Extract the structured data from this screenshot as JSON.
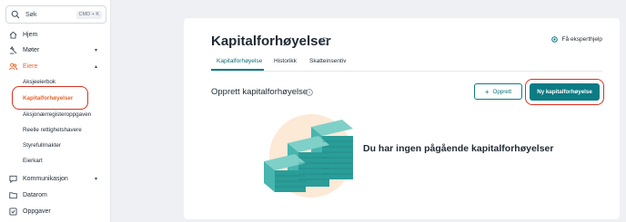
{
  "search": {
    "placeholder": "Søk",
    "shortcut": "CMD + K"
  },
  "sidebar": {
    "items": [
      {
        "label": "Hjem",
        "icon": "home-icon"
      },
      {
        "label": "Møter",
        "icon": "gavel-icon",
        "chevron": "▾"
      },
      {
        "label": "Eiere",
        "icon": "people-icon",
        "chevron": "▴"
      },
      {
        "label": "Kommunikasjon",
        "icon": "chat-icon",
        "chevron": "▾"
      },
      {
        "label": "Datarom",
        "icon": "folder-icon"
      },
      {
        "label": "Oppgaver",
        "icon": "check-square-icon"
      }
    ],
    "eiere_sub": [
      "Aksjeeierbok",
      "Kapitalforhøyelser",
      "Aksjonærregisteroppgaven",
      "Reelle rettighetshavere",
      "Styrefullmakter",
      "Eierkart"
    ]
  },
  "page": {
    "title": "Kapitalforhøyelser",
    "expert_link": "Få eksperthjelp",
    "tabs": [
      "Kapitalforhøyelse",
      "Historikk",
      "Skatteinsentiv"
    ],
    "section_title": "Opprett kapitalforhøyelse",
    "outline_button": "Opprett",
    "primary_button": "Ny kapitalforhøyelse",
    "empty_state": "Du har ingen pågående kapitalforhøyelser"
  },
  "colors": {
    "accent": "#0c7b84",
    "active_nav": "#e8642c",
    "highlight_ring": "#d9321f"
  }
}
